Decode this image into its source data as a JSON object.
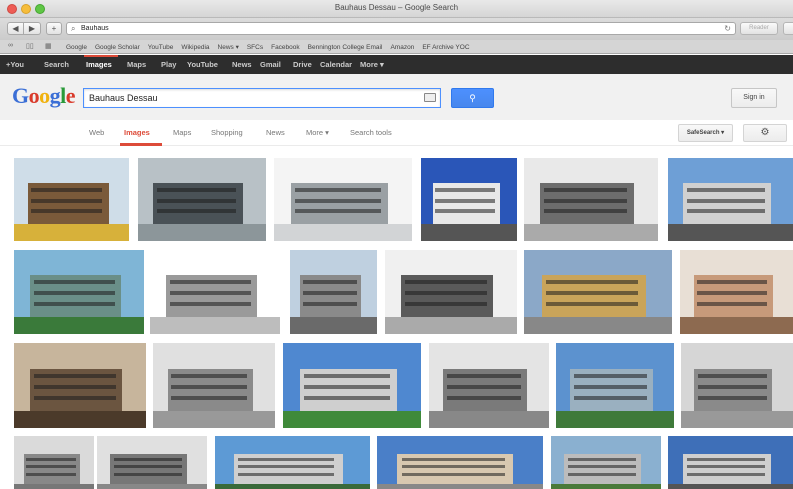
{
  "window": {
    "title": "Bauhaus Dessau – Google Search"
  },
  "toolbar": {
    "back_label": "◀",
    "forward_label": "▶",
    "add_label": "+",
    "url_value": "Bauhaus",
    "reader_label": "Reader"
  },
  "bookmarks": {
    "items": [
      "Google",
      "Google Scholar",
      "YouTube",
      "Wikipedia",
      "News ▾",
      "SFCs",
      "Facebook",
      "Bennington College Email",
      "Amazon",
      "EF Archive YOC"
    ]
  },
  "gbar": {
    "items": [
      {
        "label": "+You",
        "active": false
      },
      {
        "label": "Search",
        "active": false
      },
      {
        "label": "Images",
        "active": true
      },
      {
        "label": "Maps",
        "active": false
      },
      {
        "label": "Play",
        "active": false
      },
      {
        "label": "YouTube",
        "active": false
      },
      {
        "label": "News",
        "active": false
      },
      {
        "label": "Gmail",
        "active": false
      },
      {
        "label": "Drive",
        "active": false
      },
      {
        "label": "Calendar",
        "active": false
      },
      {
        "label": "More ▾",
        "active": false
      }
    ]
  },
  "header": {
    "logo_text": "Google",
    "search_value": "Bauhaus Dessau",
    "search_button_icon": "search-icon",
    "signin_label": "Sign in"
  },
  "tabs": {
    "items": [
      {
        "label": "Web",
        "active": false
      },
      {
        "label": "Images",
        "active": true
      },
      {
        "label": "Maps",
        "active": false
      },
      {
        "label": "Shopping",
        "active": false
      },
      {
        "label": "News",
        "active": false
      },
      {
        "label": "More ▾",
        "active": false
      },
      {
        "label": "Search tools",
        "active": false
      }
    ],
    "safesearch_label": "SafeSearch ▾",
    "settings_icon": "gear-icon"
  },
  "colors": {
    "accent_red": "#dd4b39",
    "blue_button": "#4d90fe",
    "gbar_bg": "#2d2d2d",
    "header_bg": "#f1f1f1"
  }
}
